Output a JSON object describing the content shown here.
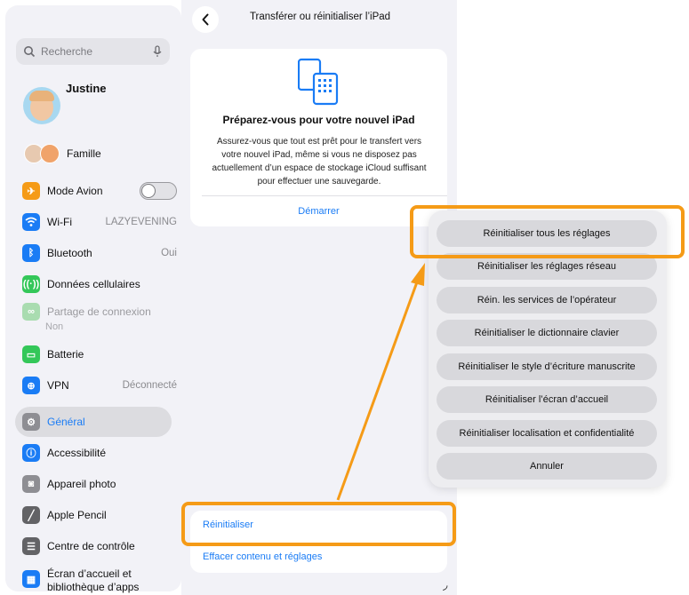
{
  "sidebar": {
    "search_placeholder": "Recherche",
    "profile_name": "Justine",
    "family_label": "Famille",
    "items": [
      {
        "label": "Mode Avion",
        "value": "",
        "icon": "airplane-icon",
        "color": "#f59b17"
      },
      {
        "label": "Wi-Fi",
        "value": "LAZYEVENING",
        "icon": "wifi-icon",
        "color": "#1a7cf5"
      },
      {
        "label": "Bluetooth",
        "value": "Oui",
        "icon": "bluetooth-icon",
        "color": "#1a7cf5"
      },
      {
        "label": "Données cellulaires",
        "value": "",
        "icon": "antenna-icon",
        "color": "#34c759"
      },
      {
        "label": "Partage de connexion",
        "value": "",
        "sub": "Non",
        "icon": "hotspot-icon",
        "color": "#a9dcb0"
      },
      {
        "label": "Batterie",
        "value": "",
        "icon": "battery-icon",
        "color": "#34c759"
      },
      {
        "label": "VPN",
        "value": "Déconnecté",
        "icon": "vpn-globe-icon",
        "color": "#1a7cf5"
      },
      {
        "label": "Général",
        "value": "",
        "icon": "gear-icon",
        "color": "#8e8e93"
      },
      {
        "label": "Accessibilité",
        "value": "",
        "icon": "accessibility-icon",
        "color": "#1a7cf5"
      },
      {
        "label": "Appareil photo",
        "value": "",
        "icon": "camera-icon",
        "color": "#8e8e93"
      },
      {
        "label": "Apple Pencil",
        "value": "",
        "icon": "pencil-icon",
        "color": "#636366"
      },
      {
        "label": "Centre de contrôle",
        "value": "",
        "icon": "toggles-icon",
        "color": "#636366"
      },
      {
        "label": "Écran d’accueil et bibliothèque d’apps",
        "value": "",
        "icon": "home-screen-icon",
        "color": "#1a7cf5"
      }
    ]
  },
  "main": {
    "title": "Transférer ou réinitialiser l’iPad",
    "card_heading": "Préparez-vous pour votre nouvel iPad",
    "card_description": "Assurez-vous que tout est prêt pour le transfert vers votre nouvel iPad, même si vous ne disposez pas actuellement d’un espace de stockage iCloud suffisant pour effectuer une sauvegarde.",
    "start_label": "Démarrer",
    "reset_label": "Réinitialiser",
    "erase_label": "Effacer contenu et réglages"
  },
  "action_sheet": {
    "options": [
      "Réinitialiser tous les réglages",
      "Réinitialiser les réglages réseau",
      "Réin. les services de l’opérateur",
      "Réinitialiser le dictionnaire clavier",
      "Réinitialiser le style d’écriture manuscrite",
      "Réinitialiser l’écran d’accueil",
      "Réinitialiser localisation et confidentialité",
      "Annuler"
    ]
  },
  "colors": {
    "accent": "#1a7cf5",
    "highlight": "#f59b17"
  }
}
